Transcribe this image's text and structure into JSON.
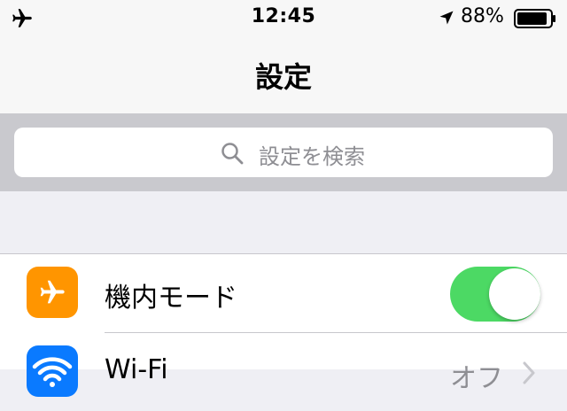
{
  "status_bar": {
    "time": "12:45",
    "battery_percent": "88%",
    "icons": [
      "airplane-icon",
      "location-arrow-icon",
      "battery-icon"
    ]
  },
  "nav": {
    "title": "設定"
  },
  "search": {
    "placeholder": "設定を検索",
    "icon": "search-icon"
  },
  "settings": {
    "items": [
      {
        "label": "機内モード",
        "icon": "airplane-icon",
        "icon_color": "#ff9500",
        "toggle_on": true
      },
      {
        "label": "Wi-Fi",
        "icon": "wifi-icon",
        "icon_color": "#0a7aff",
        "value": "オフ"
      }
    ]
  },
  "colors": {
    "toggle_on": "#4cd964",
    "background": "#efeff4",
    "search_bar_bg": "#c9c9ce"
  }
}
